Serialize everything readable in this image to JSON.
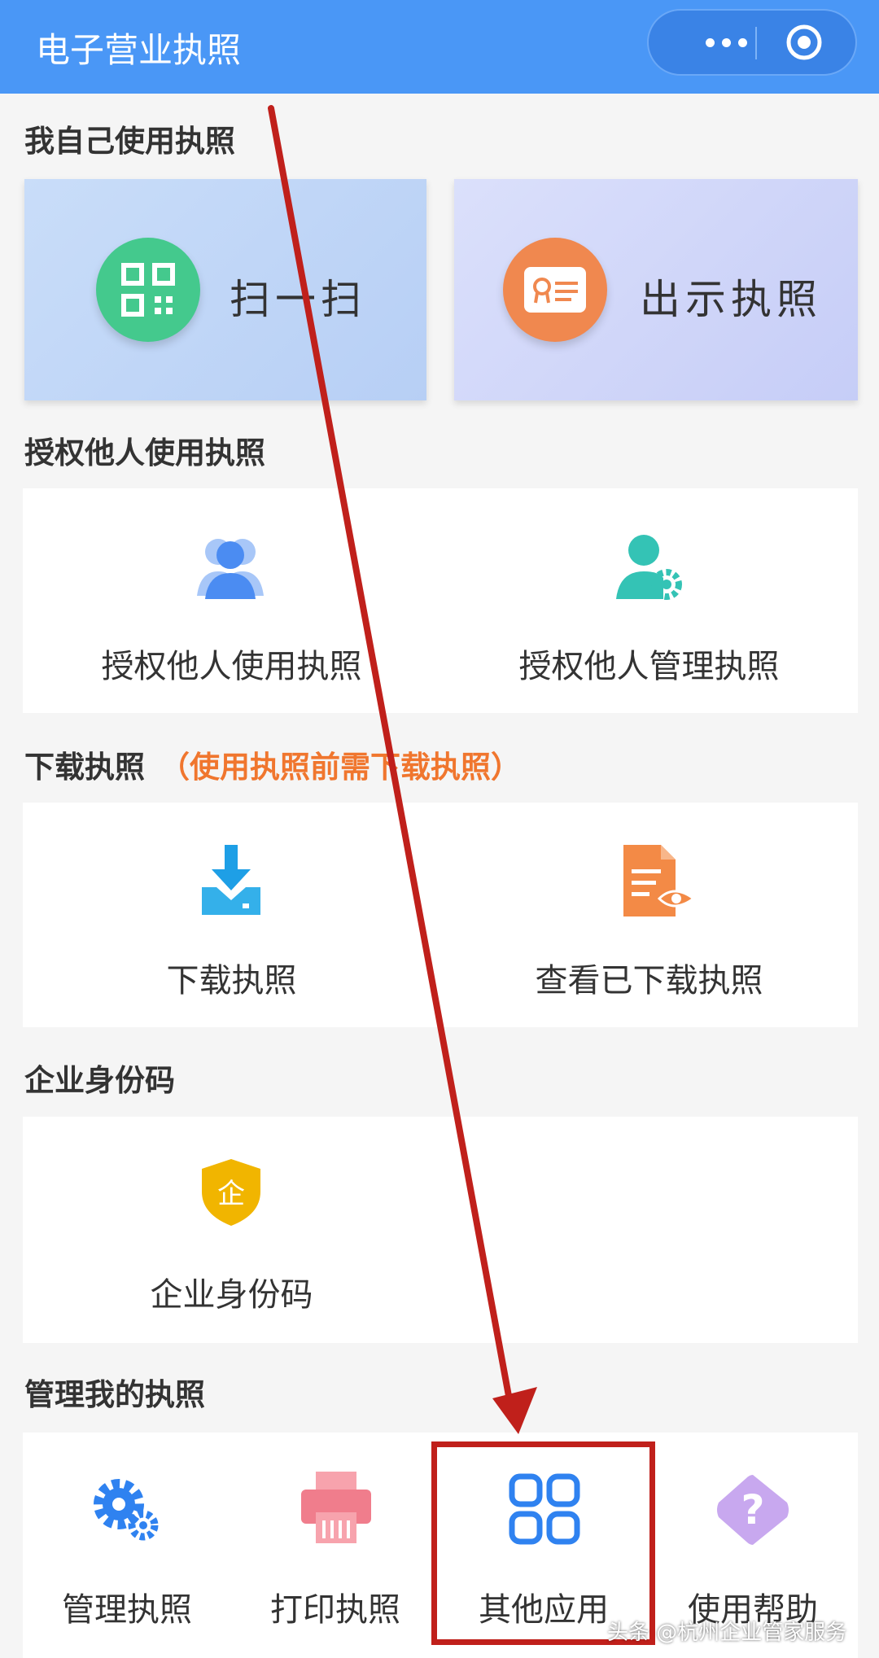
{
  "nav": {
    "title": "电子营业执照",
    "more_label": "更多",
    "close_label": "关闭"
  },
  "section_self": {
    "title": "我自己使用执照",
    "items": [
      {
        "label": "扫一扫"
      },
      {
        "label": "出示执照"
      }
    ]
  },
  "section_authorize": {
    "title": "授权他人使用执照",
    "items": [
      {
        "label": "授权他人使用执照"
      },
      {
        "label": "授权他人管理执照"
      }
    ]
  },
  "section_download": {
    "title": "下载执照",
    "note": "（使用执照前需下载执照）",
    "items": [
      {
        "label": "下载执照"
      },
      {
        "label": "查看已下载执照"
      }
    ]
  },
  "section_identity": {
    "title": "企业身份码",
    "items": [
      {
        "label": "企业身份码"
      }
    ],
    "badge_char": "企"
  },
  "section_manage": {
    "title": "管理我的执照",
    "items": [
      {
        "label": "管理执照"
      },
      {
        "label": "打印执照"
      },
      {
        "label": "其他应用"
      },
      {
        "label": "使用帮助"
      }
    ]
  },
  "watermark": "头条 @杭州企业管家服务",
  "colors": {
    "nav": "#4a97f6",
    "accent_orange": "#f0762e",
    "annotation_red": "#c0201b"
  }
}
